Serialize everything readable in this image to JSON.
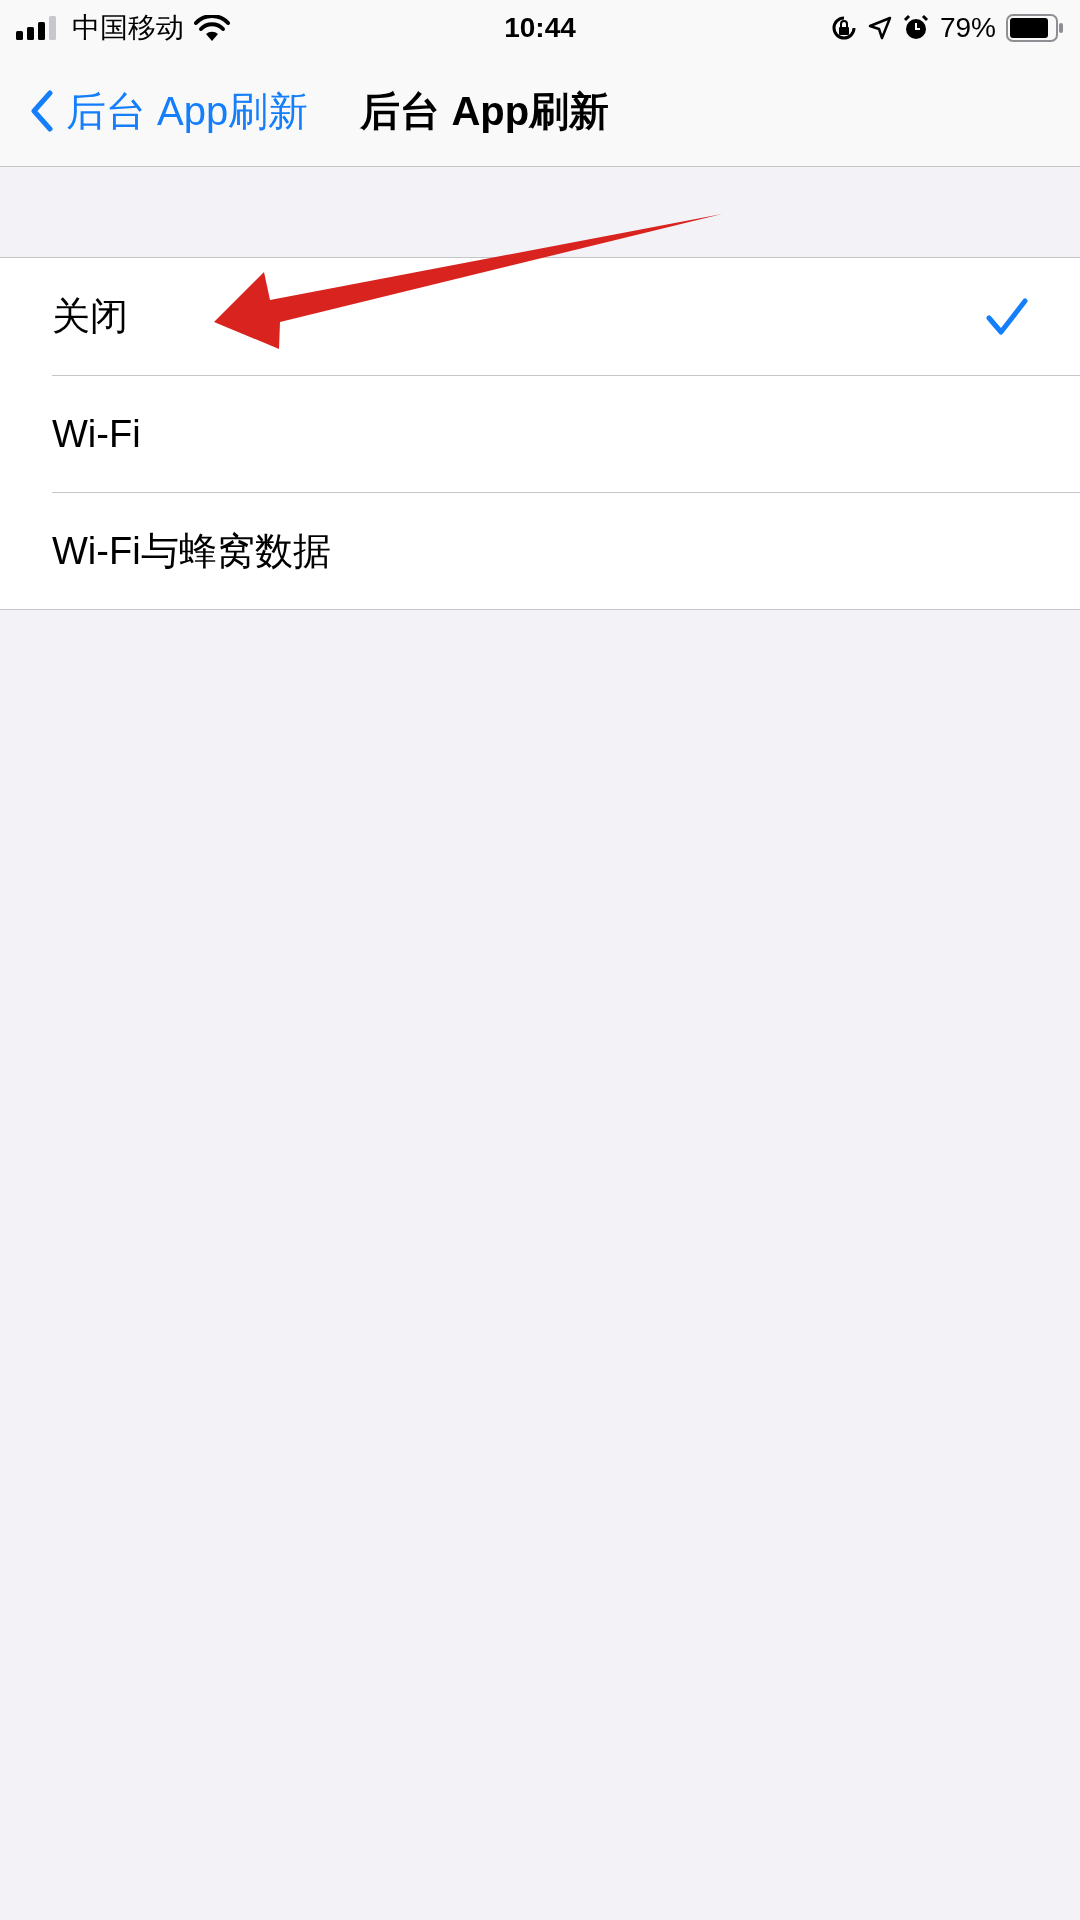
{
  "status_bar": {
    "carrier": "中国移动",
    "time": "10:44",
    "battery": "79%"
  },
  "nav": {
    "back": "后台 App刷新",
    "title": "后台 App刷新"
  },
  "options": [
    {
      "label": "关闭",
      "selected": true
    },
    {
      "label": "Wi-Fi",
      "selected": false
    },
    {
      "label": "Wi-Fi与蜂窝数据",
      "selected": false
    }
  ]
}
